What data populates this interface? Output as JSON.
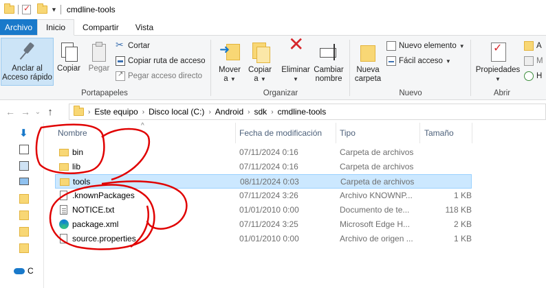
{
  "window": {
    "title": "cmdline-tools"
  },
  "tabs": [
    {
      "label": "Archivo"
    },
    {
      "label": "Inicio"
    },
    {
      "label": "Compartir"
    },
    {
      "label": "Vista"
    }
  ],
  "ribbon": {
    "clipboard": {
      "group_label": "Portapapeles",
      "pin_label_1": "Anclar al",
      "pin_label_2": "Acceso rápido",
      "copy": "Copiar",
      "paste": "Pegar",
      "cut": "Cortar",
      "copy_path": "Copiar ruta de acceso",
      "paste_shortcut": "Pegar acceso directo"
    },
    "organize": {
      "group_label": "Organizar",
      "move_1": "Mover",
      "move_2": "a",
      "copy_1": "Copiar",
      "copy_2": "a",
      "delete": "Eliminar",
      "rename_1": "Cambiar",
      "rename_2": "nombre"
    },
    "new": {
      "group_label": "Nuevo",
      "new_folder_1": "Nueva",
      "new_folder_2": "carpeta",
      "new_item": "Nuevo elemento",
      "easy_access": "Fácil acceso"
    },
    "open": {
      "group_label": "Abrir",
      "properties": "Propiedades",
      "open_short": "A",
      "edit_short": "M",
      "history_short": "H"
    }
  },
  "address": {
    "crumbs": [
      "Este equipo",
      "Disco local (C:)",
      "Android",
      "sdk",
      "cmdline-tools"
    ]
  },
  "navpane": {
    "cloud_label": "C"
  },
  "columns": {
    "name": "Nombre",
    "date": "Fecha de modificación",
    "type": "Tipo",
    "size": "Tamaño"
  },
  "files": [
    {
      "name": "bin",
      "date": "07/11/2024 0:16",
      "type": "Carpeta de archivos",
      "size": "",
      "icon": "folder-icon"
    },
    {
      "name": "lib",
      "date": "07/11/2024 0:16",
      "type": "Carpeta de archivos",
      "size": "",
      "icon": "folder-icon"
    },
    {
      "name": "tools",
      "date": "08/11/2024 0:03",
      "type": "Carpeta de archivos",
      "size": "",
      "icon": "folder-icon",
      "selected": true
    },
    {
      "name": ".knownPackages",
      "date": "07/11/2024 3:26",
      "type": "Archivo KNOWNP...",
      "size": "1 KB",
      "icon": "file-icon"
    },
    {
      "name": "NOTICE.txt",
      "date": "01/01/2010 0:00",
      "type": "Documento de te...",
      "size": "118 KB",
      "icon": "text-file-icon"
    },
    {
      "name": "package.xml",
      "date": "07/11/2024 3:25",
      "type": "Microsoft Edge H...",
      "size": "2 KB",
      "icon": "edge-icon"
    },
    {
      "name": "source.properties",
      "date": "01/01/2010 0:00",
      "type": "Archivo de origen ...",
      "size": "1 KB",
      "icon": "properties-file-icon"
    }
  ],
  "colors": {
    "file_tab": "#1979ca",
    "selection": "#cce8ff",
    "annotation": "#e00000",
    "folder": "#f8d775"
  }
}
